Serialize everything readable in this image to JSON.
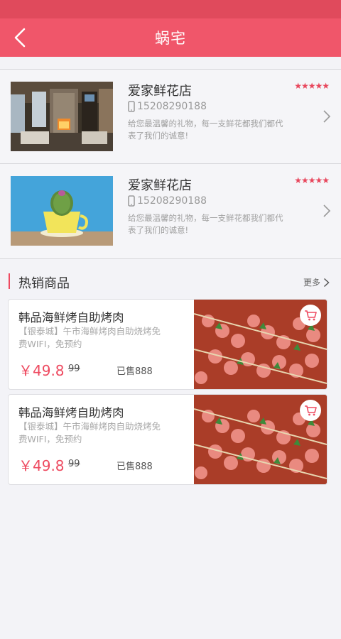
{
  "header": {
    "title": "蜗宅",
    "back_icon": "chevron-left-icon"
  },
  "shops": [
    {
      "name": "爱家鲜花店",
      "rating_stars": 5,
      "rating_text": "★★★★★",
      "phone": "15208290188",
      "desc": "给您最温馨的礼物，每一支鲜花都我们都代表了我们的诚意!",
      "image": "living-room-photo"
    },
    {
      "name": "爱家鲜花店",
      "rating_stars": 5,
      "rating_text": "★★★★★",
      "phone": "15208290188",
      "desc": "给您最温馨的礼物，每一支鲜花都我们都代表了我们的诚意!",
      "image": "cactus-cup-photo"
    }
  ],
  "section": {
    "title": "热销商品",
    "more_label": "更多"
  },
  "products": [
    {
      "name": "韩品海鲜烤自助烤肉",
      "address": "【银泰城】午市海鲜烤肉自助烧烤免费WIFI，免预约",
      "price": "￥49.8",
      "original_price": "99",
      "sold": "已售888",
      "image": "bbq-skewers-photo"
    },
    {
      "name": "韩品海鲜烤自助烤肉",
      "address": "【银泰城】午市海鲜烤肉自助烧烤免费WIFI，免预约",
      "price": "￥49.8",
      "original_price": "99",
      "sold": "已售888",
      "image": "bbq-skewers-photo"
    }
  ],
  "colors": {
    "brand": "#f0566a",
    "status_bar": "#e04a5c",
    "accent_price": "#ee4a60",
    "background": "#f3f3f7"
  }
}
